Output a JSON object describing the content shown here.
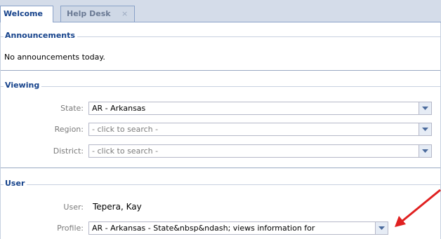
{
  "tabs": [
    {
      "label": "Welcome"
    },
    {
      "label": "Help Desk",
      "close_icon": "×"
    }
  ],
  "announcements": {
    "legend": "Announcements",
    "text": "No announcements today."
  },
  "viewing": {
    "legend": "Viewing",
    "state_label": "State:",
    "state_value": "AR - Arkansas",
    "region_label": "Region:",
    "region_value": "- click to search -",
    "district_label": "District:",
    "district_value": "- click to search -"
  },
  "user": {
    "legend": "User",
    "user_label": "User:",
    "user_value": "Tepera, Kay",
    "profile_label": "Profile:",
    "profile_value": "AR - Arkansas - State&nbsp&ndash; views information for"
  },
  "colors": {
    "accent": "#15428b",
    "annotation_arrow": "#e02020"
  }
}
